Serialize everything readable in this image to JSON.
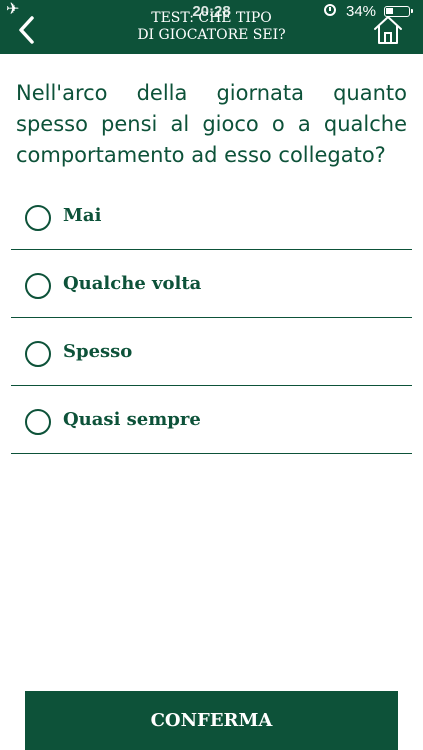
{
  "status_bar": {
    "time": "20:28",
    "battery_percent": "34%",
    "battery_level": 0.34,
    "airplane_icon": "airplane-icon",
    "alarm_icon": "alarm-icon",
    "battery_icon": "battery-icon"
  },
  "header": {
    "title_line1": "TEST: CHE TIPO",
    "title_line2": "DI GIOCATORE SEI?",
    "back_icon": "chevron-left-icon",
    "home_icon": "home-icon"
  },
  "question": {
    "text": "Nell'arco della giornata quanto spesso pensi al gioco o a qualche comportamento ad esso collegato?"
  },
  "options": [
    {
      "label": "Mai"
    },
    {
      "label": "Qualche volta"
    },
    {
      "label": "Spesso"
    },
    {
      "label": "Quasi sempre"
    }
  ],
  "confirm": {
    "label": "CONFERMA"
  },
  "colors": {
    "brand": "#0d5239",
    "background": "#ffffff"
  }
}
